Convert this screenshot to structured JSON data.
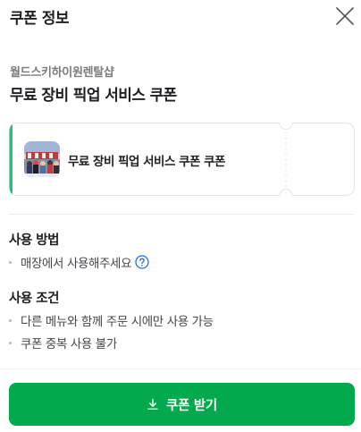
{
  "header": {
    "title": "쿠폰 정보",
    "close_icon": "close-icon"
  },
  "coupon": {
    "shop_name": "월드스키하이원렌탈샵",
    "title": "무료 장비 픽업 서비스 쿠폰",
    "ticket_name": "무료 장비 픽업 서비스 쿠폰 쿠폰",
    "accent_color": "#2bbf7a"
  },
  "usage_method": {
    "title": "사용 방법",
    "items": [
      "매장에서 사용해주세요"
    ],
    "help_icon": "help-circle-icon",
    "help_color": "#1a73e8"
  },
  "usage_conditions": {
    "title": "사용 조건",
    "items": [
      "다른 메뉴와 함께 주문 시에만 사용 가능",
      "쿠폰 중복 사용 불가"
    ]
  },
  "footer": {
    "button_label": "쿠폰 받기",
    "button_icon": "download-icon",
    "button_color": "#03a94d"
  }
}
